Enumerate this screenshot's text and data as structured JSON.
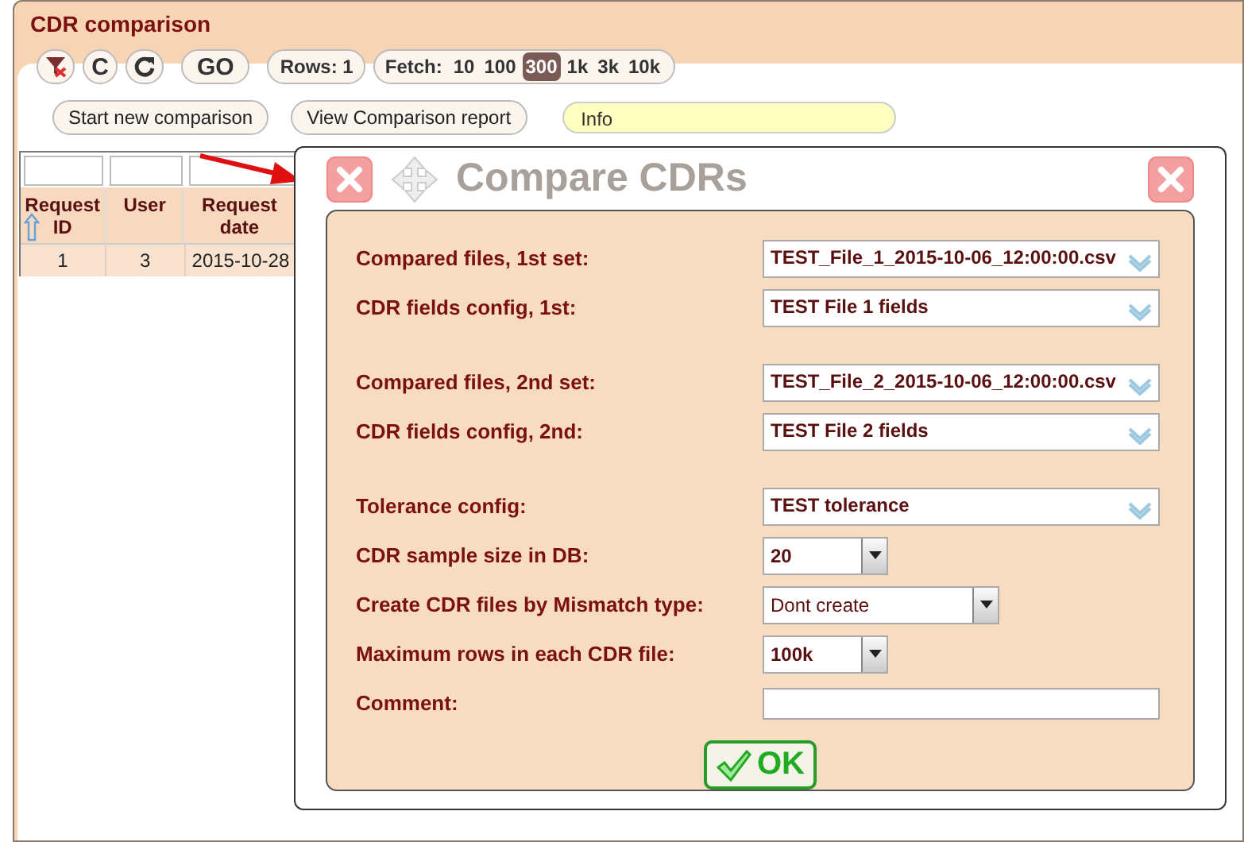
{
  "window": {
    "title": "CDR comparison"
  },
  "toolbar": {
    "go_label": "GO",
    "clear_label": "C",
    "rows": "Rows: 1",
    "fetch_label": "Fetch:",
    "fetch_options": [
      {
        "label": "10",
        "selected": false
      },
      {
        "label": "100",
        "selected": false
      },
      {
        "label": "300",
        "selected": true
      },
      {
        "label": "1k",
        "selected": false
      },
      {
        "label": "3k",
        "selected": false
      },
      {
        "label": "10k",
        "selected": false
      }
    ]
  },
  "actions": {
    "buttons": [
      "Start new comparison",
      "View Comparison report"
    ],
    "info": "Info"
  },
  "table": {
    "columns": [
      "Request ID",
      "User",
      "Request date"
    ],
    "rows": [
      [
        "1",
        "3",
        "2015-10-28"
      ]
    ]
  },
  "dialog": {
    "title": "Compare CDRs",
    "ok_label": "OK",
    "groups": [
      [
        {
          "label": "Compared files, 1st set:",
          "kind": "select",
          "value": "TEST_File_1_2015-10-06_12:00:00.csv"
        },
        {
          "label": "CDR fields config, 1st:",
          "kind": "select",
          "value": "TEST File 1 fields"
        }
      ],
      [
        {
          "label": "Compared files, 2nd set:",
          "kind": "select",
          "value": "TEST_File_2_2015-10-06_12:00:00.csv"
        },
        {
          "label": "CDR fields config, 2nd:",
          "kind": "select",
          "value": "TEST File 2 fields"
        }
      ],
      [
        {
          "label": "Tolerance config:",
          "kind": "select",
          "value": "TEST tolerance"
        },
        {
          "label": "CDR sample size in DB:",
          "kind": "combo",
          "value": "20"
        },
        {
          "label": "Create CDR files by Mismatch type:",
          "kind": "combo_wide",
          "value": "Dont create"
        },
        {
          "label": "Maximum rows in each CDR file:",
          "kind": "combo",
          "value": "100k"
        },
        {
          "label": "Comment:",
          "kind": "text"
        }
      ]
    ]
  }
}
